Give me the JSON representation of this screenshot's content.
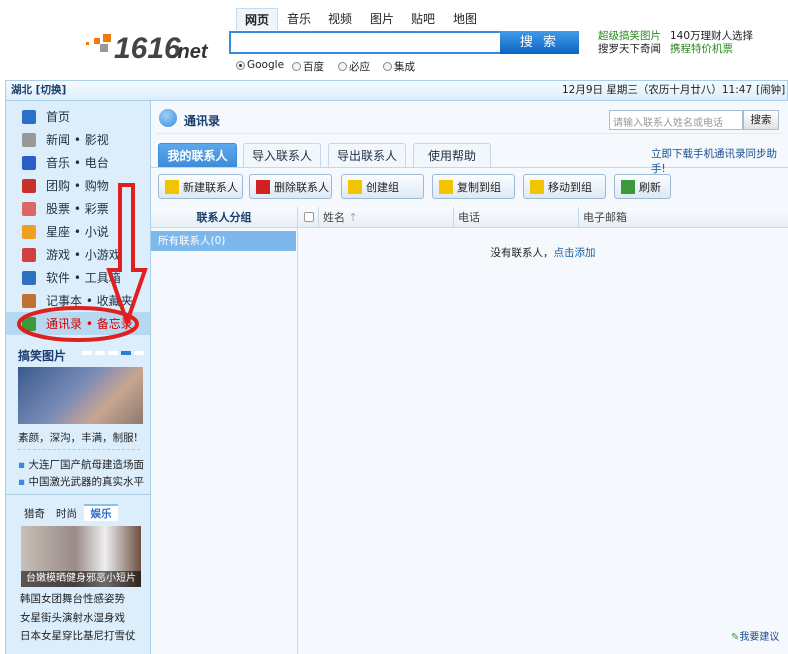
{
  "logo": {
    "text": "1616.net"
  },
  "search": {
    "tabs": [
      "网页",
      "音乐",
      "视频",
      "图片",
      "贴吧",
      "地图"
    ],
    "active_tab": 0,
    "value": "",
    "button": "搜 索",
    "engines": [
      {
        "label": "Google",
        "checked": true
      },
      {
        "label": "百度",
        "checked": false
      },
      {
        "label": "必应",
        "checked": false
      },
      {
        "label": "集成",
        "checked": false
      }
    ]
  },
  "header_links": [
    [
      "超级搞笑图片",
      "140万理财人选择"
    ],
    [
      "搜罗天下奇闻",
      "携程特价机票"
    ]
  ],
  "bar": {
    "location": "湖北 [切换]",
    "datetime": "12月9日  星期三（农历十月廿八）11:47",
    "alarm": "[闹钟]"
  },
  "sidebar": {
    "items": [
      {
        "label": "首页",
        "icon": "home-icon",
        "color": "#2a6fc9"
      },
      {
        "label": "新闻 • 影视",
        "icon": "news-icon",
        "color": "#999"
      },
      {
        "label": "音乐 • 电台",
        "icon": "music-icon",
        "color": "#2a5fc9"
      },
      {
        "label": "团购 • 购物",
        "icon": "cart-icon",
        "color": "#c8302a"
      },
      {
        "label": "股票 • 彩票",
        "icon": "stock-icon",
        "color": "#d66"
      },
      {
        "label": "星座 • 小说",
        "icon": "star-icon",
        "color": "#f0a020"
      },
      {
        "label": "游戏 • 小游戏",
        "icon": "game-icon",
        "color": "#d04040"
      },
      {
        "label": "软件 • 工具箱",
        "icon": "software-icon",
        "color": "#3070c0"
      },
      {
        "label": "记事本 • 收藏夹",
        "icon": "notepad-icon",
        "color": "#c07030"
      },
      {
        "label": "通讯录 • 备忘录",
        "icon": "contacts-icon",
        "color": "#3a9a3a",
        "selected": true
      }
    ],
    "funny": {
      "title": "搞笑图片",
      "caption": "素颜，深沟，丰满，制服!",
      "image_labels": [
        "制服",
        "深沟",
        "丰满"
      ],
      "slides": 5,
      "active_slide": 3
    },
    "news": [
      "大连厂国产航母建造场面",
      "中国激光武器的真实水平"
    ],
    "ent": {
      "tabs": [
        "猎奇",
        "时尚",
        "娱乐"
      ],
      "active_tab": 2,
      "image_caption": "台嫩模晒健身邪恶小短片",
      "links": [
        "韩国女团舞台性感姿势",
        "女星街头演射水湿身戏",
        "日本女星穿比基尼打雪仗"
      ]
    }
  },
  "main": {
    "title": "通讯录",
    "search_placeholder": "请输入联系人姓名或电话",
    "search_button": "搜索",
    "tabs": [
      "我的联系人",
      "导入联系人",
      "导出联系人",
      "使用帮助"
    ],
    "active_tab": 0,
    "sync_link": "立即下载手机通讯录同步助手!",
    "toolbar": [
      "新建联系人",
      "删除联系人",
      "创建组",
      "复制到组",
      "移动到组",
      "刷新"
    ],
    "groups_header": "联系人分组",
    "groups": [
      "所有联系人(0)"
    ],
    "columns": [
      "姓名",
      "电话",
      "电子邮箱"
    ],
    "empty_text": "没有联系人，",
    "empty_link": "点击添加",
    "feedback": "我要建议"
  }
}
